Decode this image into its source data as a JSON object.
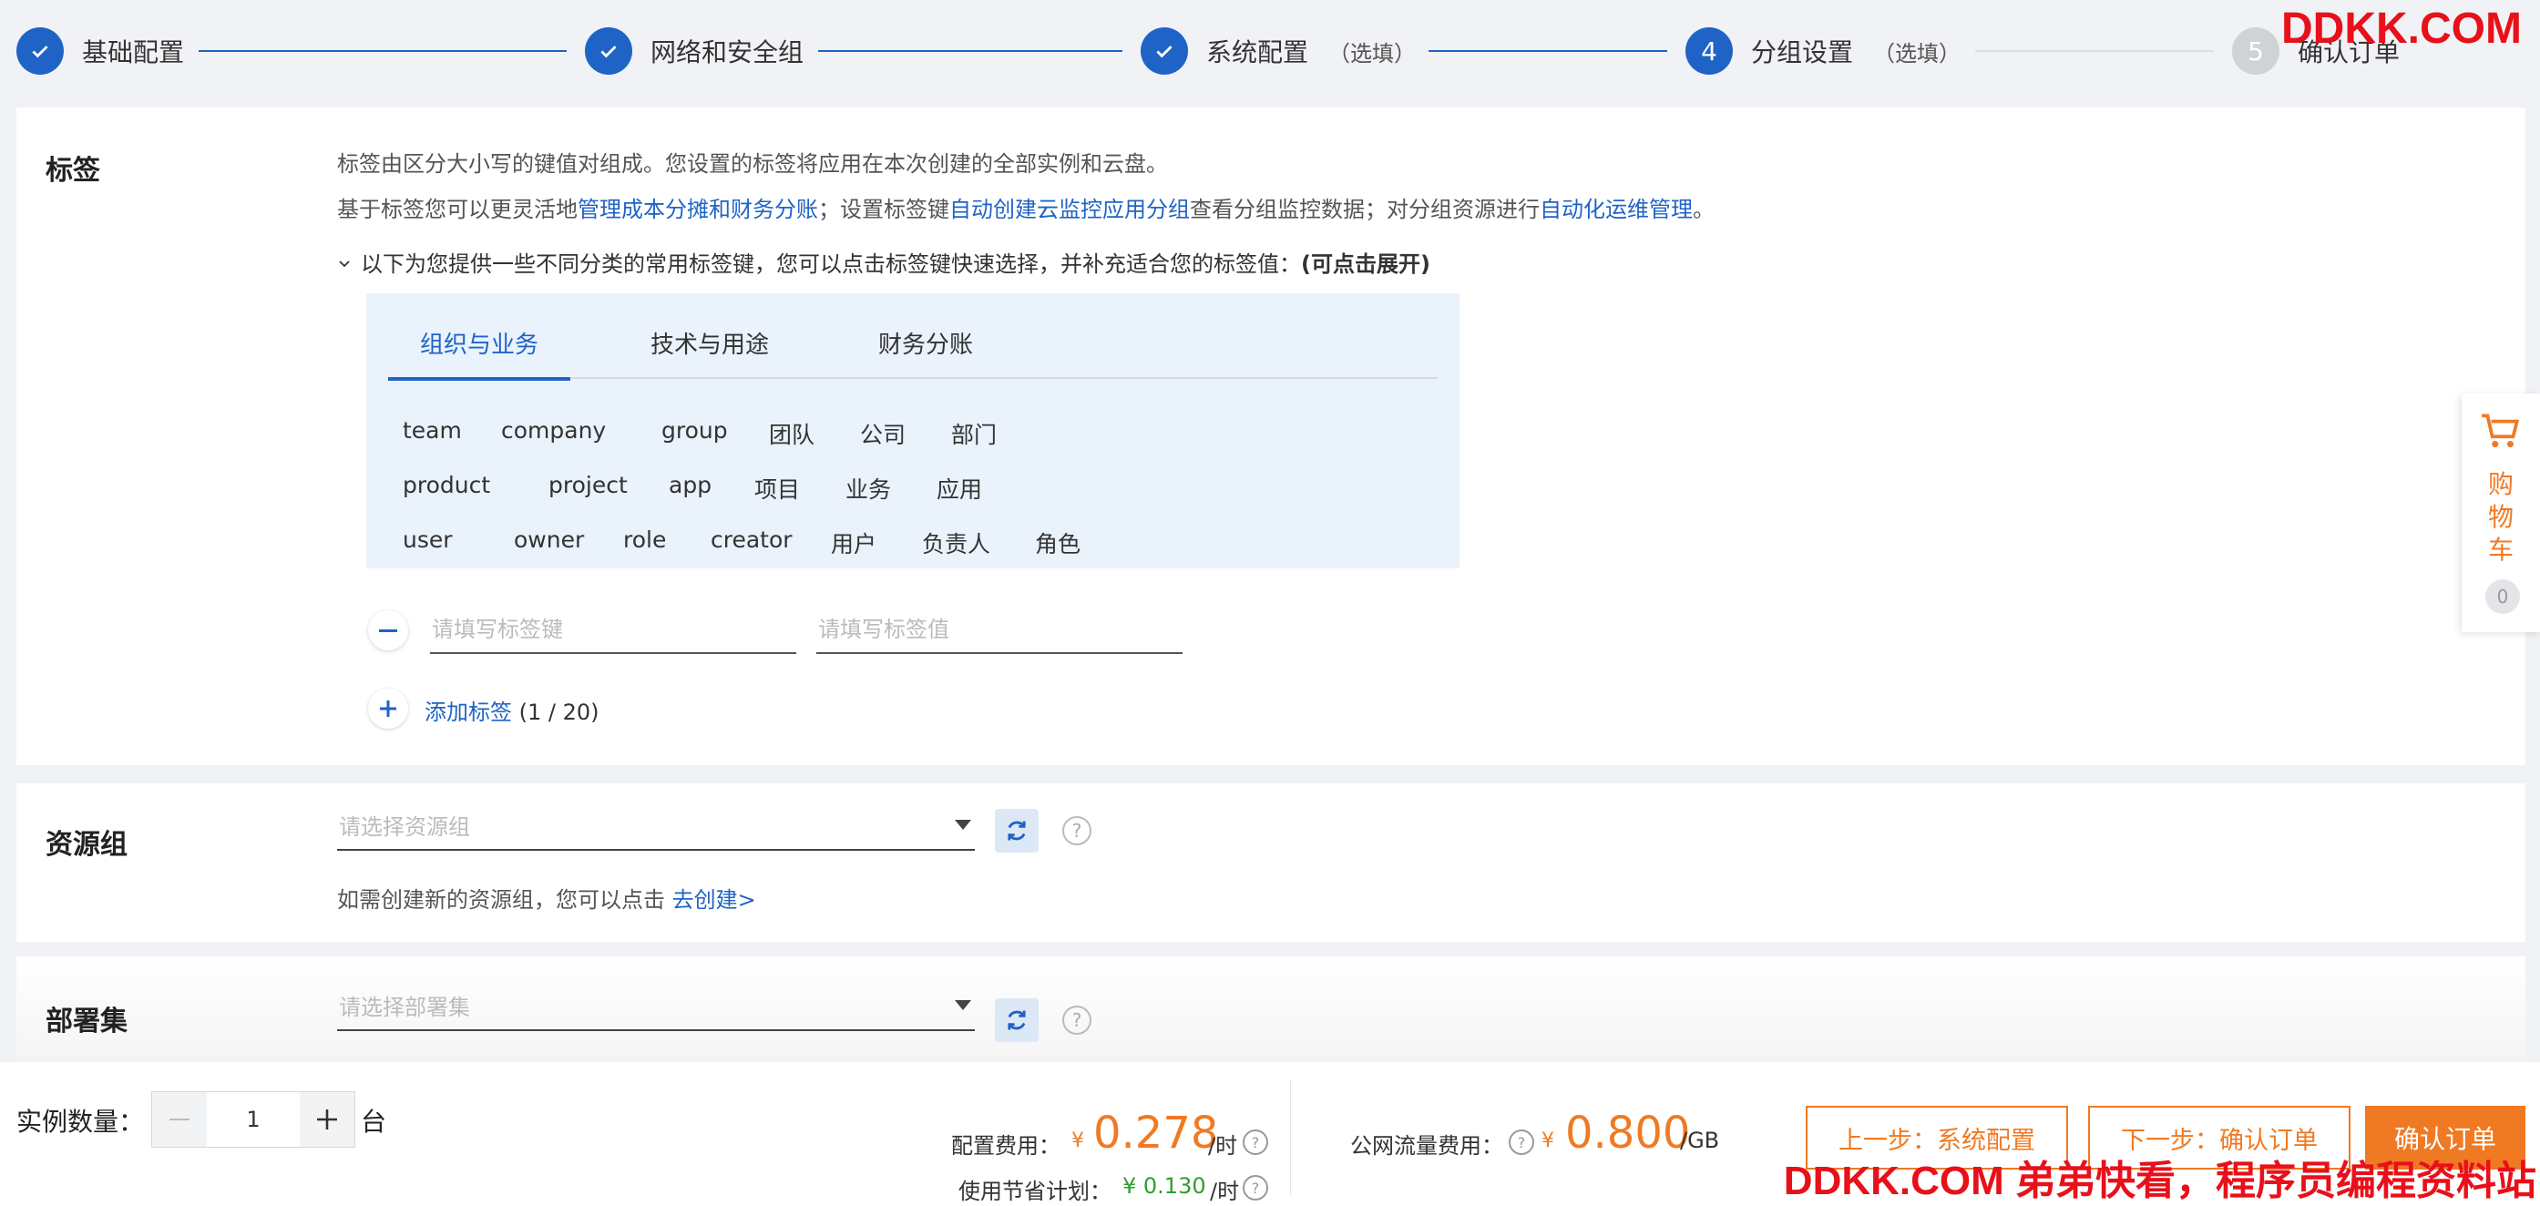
{
  "steps": [
    {
      "title": "基础配置",
      "optional": "",
      "state": "done"
    },
    {
      "title": "网络和安全组",
      "optional": "",
      "state": "done"
    },
    {
      "title": "系统配置",
      "optional": "（选填）",
      "state": "done"
    },
    {
      "number": "4",
      "title": "分组设置",
      "optional": "（选填）",
      "state": "current"
    },
    {
      "number": "5",
      "title": "确认订单",
      "optional": "",
      "state": "todo"
    }
  ],
  "watermark": {
    "top": "DDKK.COM",
    "bottom": "DDKK.COM 弟弟快看，程序员编程资料站"
  },
  "tags": {
    "label": "标签",
    "desc1": "标签由区分大小写的键值对组成。您设置的标签将应用在本次创建的全部实例和云盘。",
    "desc2_a": "基于标签您可以更灵活地",
    "desc2_link1": "管理成本分摊和财务分账",
    "desc2_b": "；设置标签键",
    "desc2_link2": "自动创建云监控应用分组",
    "desc2_c": "查看分组监控数据；对分组资源进行",
    "desc2_link3": "自动化运维管理",
    "desc2_d": "。",
    "expand_text": "以下为您提供一些不同分类的常用标签键，您可以点击标签键快速选择，并补充适合您的标签值：",
    "expand_bold": "(可点击展开)",
    "tabs": [
      "组织与业务",
      "技术与用途",
      "财务分账"
    ],
    "chip_rows": [
      [
        "team",
        "company",
        "group",
        "团队",
        "公司",
        "部门"
      ],
      [
        "product",
        "project",
        "app",
        "项目",
        "业务",
        "应用"
      ],
      [
        "user",
        "owner",
        "role",
        "creator",
        "用户",
        "负责人",
        "角色"
      ]
    ],
    "key_placeholder": "请填写标签键",
    "value_placeholder": "请填写标签值",
    "add_label": "添加标签",
    "add_count": "(1 / 20)"
  },
  "resource_group": {
    "label": "资源组",
    "placeholder": "请选择资源组",
    "hint": "如需创建新的资源组，您可以点击",
    "hint_link": "去创建>"
  },
  "deployment_set": {
    "label": "部署集",
    "placeholder": "请选择部署集"
  },
  "cart": {
    "chars": [
      "购",
      "物",
      "车"
    ],
    "count": "0"
  },
  "footer": {
    "quantity_label": "实例数量：",
    "quantity_value": "1",
    "unit": "台",
    "config_fee_label": "配置费用：",
    "currency": "¥",
    "config_fee": "0.278",
    "config_fee_unit": "/时",
    "savings_label": "使用节省计划：",
    "savings_fee": "¥ 0.130",
    "savings_unit": "/时",
    "traffic_fee_label": "公网流量费用：",
    "traffic_fee": "0.800",
    "traffic_unit": "/GB",
    "prev_button": "上一步：系统配置",
    "next_button": "下一步：确认订单",
    "confirm_button": "确认订单"
  },
  "colors": {
    "primary": "#1f63c6",
    "accent": "#f07a23",
    "watermark": "#e8101a"
  }
}
